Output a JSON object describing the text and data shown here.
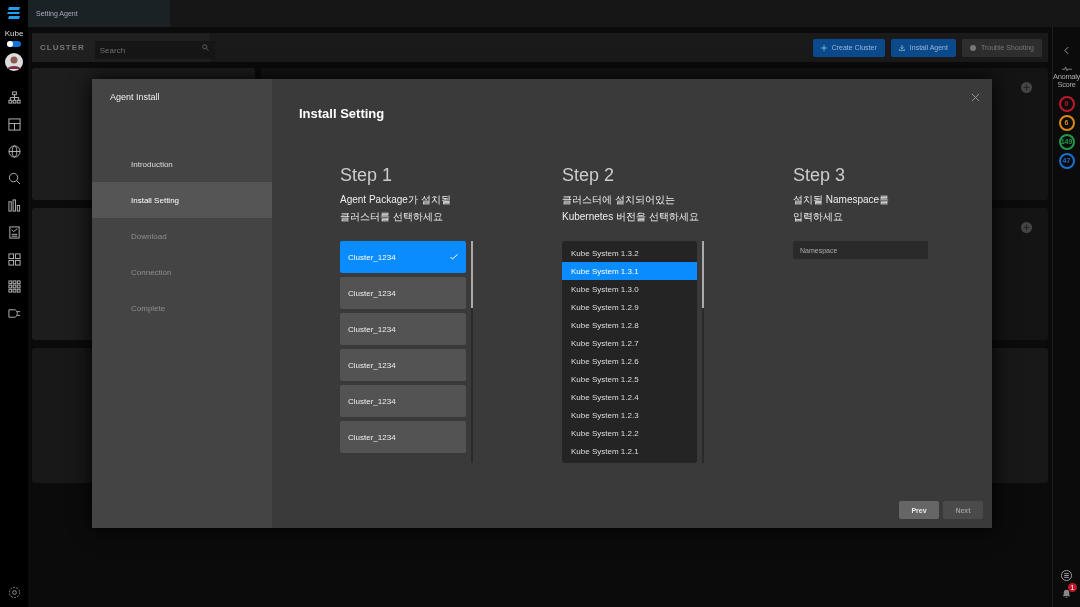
{
  "app_bar": {
    "tab_title": "Setting Agent"
  },
  "rail": {
    "brand": "Kube",
    "toggle_on": true
  },
  "toolbar": {
    "label": "CLUSTER",
    "search": {
      "placeholder": "Search"
    },
    "buttons": [
      {
        "label": "Create Cluster",
        "kind": "primary"
      },
      {
        "label": "Install Agent",
        "kind": "primary"
      },
      {
        "label": "Trouble Shooting",
        "kind": "secondary"
      }
    ]
  },
  "right_rail": {
    "label": "Anomaly Score",
    "scores": [
      {
        "value": "0",
        "color": "#c0182b"
      },
      {
        "value": "6",
        "color": "#d88a12"
      },
      {
        "value": "149",
        "color": "#1f9a4c"
      },
      {
        "value": "47",
        "color": "#1d6fd0"
      }
    ],
    "notification_count": "1"
  },
  "modal": {
    "title": "Agent Install",
    "heading": "Install Setting",
    "nav": [
      {
        "label": "Introduction",
        "selected": false,
        "disabled": false
      },
      {
        "label": "Install Setting",
        "selected": true,
        "disabled": false
      },
      {
        "label": "Download",
        "selected": false,
        "disabled": true
      },
      {
        "label": "Connection",
        "selected": false,
        "disabled": true
      },
      {
        "label": "Complete",
        "selected": false,
        "disabled": true
      }
    ],
    "steps": [
      {
        "title": "Step 1",
        "description": "Agent Package가 설치될\n클러스터를 선택하세요",
        "kind": "cards",
        "options": [
          {
            "label": "Cluster_1234",
            "selected": true
          },
          {
            "label": "Cluster_1234",
            "selected": false
          },
          {
            "label": "Cluster_1234",
            "selected": false
          },
          {
            "label": "Cluster_1234",
            "selected": false
          },
          {
            "label": "Cluster_1234",
            "selected": false
          },
          {
            "label": "Cluster_1234",
            "selected": false
          }
        ]
      },
      {
        "title": "Step 2",
        "description": "클러스터에 설치되어있는\nKubernetes 버전을 선택하세요",
        "kind": "list",
        "options": [
          {
            "label": "Kube System 1.3.2",
            "selected": false
          },
          {
            "label": "Kube System 1.3.1",
            "selected": true
          },
          {
            "label": "Kube System 1.3.0",
            "selected": false
          },
          {
            "label": "Kube System 1.2.9",
            "selected": false
          },
          {
            "label": "Kube System 1.2.8",
            "selected": false
          },
          {
            "label": "Kube System 1.2.7",
            "selected": false
          },
          {
            "label": "Kube System 1.2.6",
            "selected": false
          },
          {
            "label": "Kube System 1.2.5",
            "selected": false
          },
          {
            "label": "Kube System 1.2.4",
            "selected": false
          },
          {
            "label": "Kube System 1.2.3",
            "selected": false
          },
          {
            "label": "Kube System 1.2.2",
            "selected": false
          },
          {
            "label": "Kube System 1.2.1",
            "selected": false
          }
        ]
      },
      {
        "title": "Step 3",
        "description": "설치될 Namespace를\n입력하세요",
        "kind": "input",
        "placeholder": "Namespace"
      }
    ],
    "buttons": [
      {
        "label": "Prev",
        "disabled": false
      },
      {
        "label": "Next",
        "disabled": true
      }
    ]
  }
}
